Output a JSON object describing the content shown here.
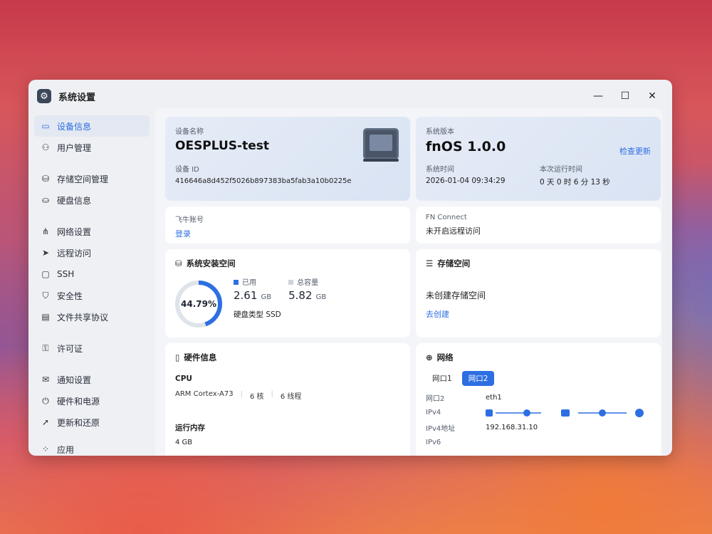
{
  "window": {
    "title": "系统设置"
  },
  "sidebar": {
    "items": [
      {
        "label": "设备信息",
        "icon": "device-icon",
        "glyph": "▭",
        "active": true
      },
      {
        "label": "用户管理",
        "icon": "users-icon",
        "glyph": "⚇"
      },
      {
        "label": "存储空间管理",
        "icon": "storage-icon",
        "glyph": "⛁"
      },
      {
        "label": "硬盘信息",
        "icon": "disk-icon",
        "glyph": "⛀"
      },
      {
        "label": "网络设置",
        "icon": "network-icon",
        "glyph": "⋔"
      },
      {
        "label": "远程访问",
        "icon": "send-icon",
        "glyph": "➤"
      },
      {
        "label": "SSH",
        "icon": "terminal-icon",
        "glyph": "▢"
      },
      {
        "label": "安全性",
        "icon": "shield-icon",
        "glyph": "⛉"
      },
      {
        "label": "文件共享协议",
        "icon": "file-share-icon",
        "glyph": "▤"
      },
      {
        "label": "许可证",
        "icon": "key-icon",
        "glyph": "⚿"
      },
      {
        "label": "通知设置",
        "icon": "mail-icon",
        "glyph": "✉"
      },
      {
        "label": "硬件和电源",
        "icon": "power-icon",
        "glyph": "⏻"
      },
      {
        "label": "更新和还原",
        "icon": "rocket-icon",
        "glyph": "➚"
      },
      {
        "label": "应用",
        "icon": "apps-icon",
        "glyph": "⁘"
      }
    ]
  },
  "device": {
    "name_label": "设备名称",
    "name": "OESPLUS-test",
    "id_label": "设备 ID",
    "id": "416646a8d452f5026b897383ba5fab3a10b0225e"
  },
  "system": {
    "version_label": "系统版本",
    "version": "fnOS 1.0.0",
    "check_update": "检查更新",
    "time_label": "系统时间",
    "time": "2026-01-04 09:34:29",
    "uptime_label": "本次运行时间",
    "uptime": "0 天 0 时 6 分 13 秒"
  },
  "account": {
    "label": "飞牛账号",
    "login": "登录"
  },
  "fnconnect": {
    "label": "FN Connect",
    "status": "未开启远程访问"
  },
  "install_space": {
    "title": "系统安装空间",
    "percent_text": "44.79%",
    "percent": 44.79,
    "used_label": "已用",
    "used_value": "2.61",
    "used_unit": "GB",
    "total_label": "总容量",
    "total_value": "5.82",
    "total_unit": "GB",
    "disk_type": "硬盘类型 SSD",
    "accent": "#2d6fe3",
    "track": "#dfe3ea"
  },
  "storage": {
    "title": "存储空间",
    "status": "未创建存储空间",
    "create": "去创建"
  },
  "hardware": {
    "title": "硬件信息",
    "cpu_label": "CPU",
    "cpu_model": "ARM Cortex-A73",
    "cores": "6 核",
    "threads": "6 线程",
    "ram_label": "运行内存",
    "ram_value": "4 GB"
  },
  "network": {
    "title": "网络",
    "tabs": [
      "网口1",
      "网口2"
    ],
    "active_tab": 1,
    "rows": [
      {
        "key": "网口2",
        "value": "eth1"
      },
      {
        "key": "IPv4",
        "value": ""
      },
      {
        "key": "IPv4地址",
        "value": "192.168.31.10"
      },
      {
        "key": "IPv6",
        "value": ""
      }
    ]
  }
}
